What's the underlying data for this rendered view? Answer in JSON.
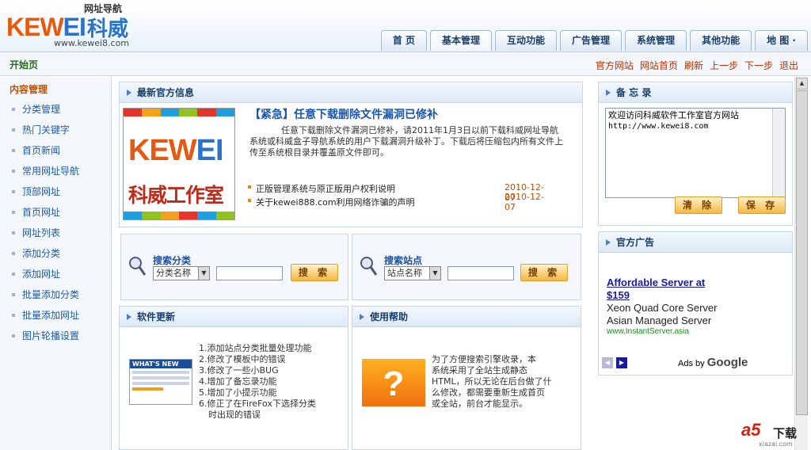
{
  "logo": {
    "subtitle": "网址导航",
    "brand_a": "KEW",
    "brand_b": "EI",
    "brand_cn": "科威",
    "url": "www.kewei8.com"
  },
  "nav": {
    "tabs": [
      "首 页",
      "基本管理",
      "互动功能",
      "广告管理",
      "系统管理",
      "其他功能",
      "地 图 ·"
    ],
    "active_index": 1
  },
  "bar": {
    "start": "开始页",
    "links": [
      "官方网站",
      "网站首页",
      "刷新",
      "上一步",
      "下一步",
      "退出"
    ]
  },
  "sidebar": {
    "title": "内容管理",
    "items": [
      "分类管理",
      "热门关键字",
      "首页新闻",
      "常用网址导航",
      "顶部网址",
      "首页网址",
      "网址列表",
      "添加分类",
      "添加网址",
      "批量添加分类",
      "批量添加网址",
      "图片轮播设置"
    ]
  },
  "news": {
    "header": "最新官方信息",
    "image_text_a": "KEW",
    "image_text_b": "EI",
    "image_text_cn": "科威工作室",
    "headline": "【紧急】任意下载删除文件漏洞已修补",
    "body": "任意下载删除文件漏洞已修补，请2011年1月3日以前下载科威网址导航系统或科威盒子导航系统的用户下载漏洞升级补丁。下载后将压缩包内所有文件上传至系统根目录并覆盖原文件即可。",
    "items": [
      {
        "title": "正版管理系统与原正版用户权利说明",
        "date": "2010-12-07"
      },
      {
        "title": "关于kewei888.com利用网络诈骗的声明",
        "date": "2010-12-07"
      }
    ]
  },
  "search_cat": {
    "label": "搜索分类",
    "select": "分类名称",
    "button": "搜 索"
  },
  "search_site": {
    "label": "搜索站点",
    "select": "站点名称",
    "button": "搜 索"
  },
  "update": {
    "header": "软件更新",
    "image_label": "WHAT'S NEW",
    "items": [
      "1.添加站点分类批量处理功能",
      "2.修改了模板中的错误",
      "3.修改了一些小BUG",
      "4.增加了备忘录功能",
      "5.增加了小提示功能",
      "6.修正了在FireFox下选择分类",
      "时出现的错误"
    ]
  },
  "help": {
    "header": "使用帮助",
    "lines": [
      "为了方便搜索引擎收录，本",
      "系统采用了全站生成静态",
      "HTML，所以无论在后台做了什",
      "么修改，都需要重新生成首页",
      "或全站，前台才能显示。"
    ]
  },
  "memo": {
    "header": "备 忘 录",
    "lines": [
      "欢迎访问科威软件工作室官方网站",
      "http://www.kewei8.com"
    ],
    "clear": "清 除",
    "save": "保 存"
  },
  "ads": {
    "header": "官方广告",
    "headline_1": "Affordable Server at",
    "headline_2": "$159",
    "line1": "Xeon Quad Core Server",
    "line2": "Asian Managed Server",
    "url": "www.InstantServer.asia",
    "ads_by": "Ads by",
    "google": "Google"
  },
  "watermark": {
    "a": "a5",
    "b": "下载",
    "url": "xiazai.com"
  }
}
